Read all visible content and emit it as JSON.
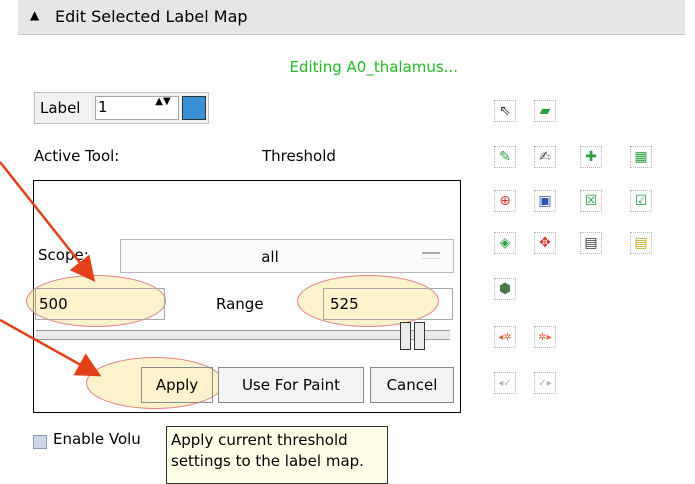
{
  "panel": {
    "title": "Edit Selected Label Map",
    "collapse_glyph": "▲",
    "status": "Editing A0_thalamus..."
  },
  "label": {
    "caption": "Label",
    "value": "1",
    "spin_glyph": "▲▼",
    "swatch_color": "#3b8fd6"
  },
  "active_tool": {
    "caption": "Active Tool:",
    "name": "Threshold"
  },
  "threshold": {
    "scope_label": "Scope:",
    "scope_value": "all",
    "min_value": "500",
    "range_label": "Range",
    "max_value": "525",
    "min": 500,
    "max": 525
  },
  "buttons": {
    "apply": "Apply",
    "use_for_paint": "Use For Paint",
    "cancel": "Cancel"
  },
  "footer": {
    "enable_label": "Enable Volu",
    "tooltip_line1": "Apply current threshold",
    "tooltip_line2": "settings to the label map."
  },
  "tools": [
    {
      "name": "pointer-tool-icon",
      "glyph": "⇖",
      "color": "#333333"
    },
    {
      "name": "eraser-tool-icon",
      "glyph": "▰",
      "color": "#2e9e44"
    },
    {
      "name": "paint-brush-tool-icon",
      "glyph": "✎",
      "color": "#2e9e44"
    },
    {
      "name": "draw-tool-icon",
      "glyph": "✍",
      "color": "#555555"
    },
    {
      "name": "level-tracing-tool-icon",
      "glyph": "✚",
      "color": "#2e9e44"
    },
    {
      "name": "grid-tool-icon",
      "glyph": "▦",
      "color": "#2e9e44"
    },
    {
      "name": "identify-islands-tool-icon",
      "glyph": "⊕",
      "color": "#d23b2b"
    },
    {
      "name": "change-label-tool-icon",
      "glyph": "▣",
      "color": "#3355aa"
    },
    {
      "name": "remove-islands-tool-icon",
      "glyph": "☒",
      "color": "#2e9e44"
    },
    {
      "name": "save-island-tool-icon",
      "glyph": "☑",
      "color": "#2e9e44"
    },
    {
      "name": "dilate-tool-icon",
      "glyph": "◈",
      "color": "#2e9e44"
    },
    {
      "name": "erode-tool-icon",
      "glyph": "✥",
      "color": "#d23b2b"
    },
    {
      "name": "morphology-tool-icon",
      "glyph": "▤",
      "color": "#333333"
    },
    {
      "name": "make-model-tool-icon",
      "glyph": "▤",
      "color": "#c9a218"
    },
    {
      "name": "wand-effect-tool-icon",
      "glyph": "⬢",
      "color": "#4a7a4a"
    },
    {
      "name": "undo-icon",
      "glyph": "◂✲",
      "color": "#e0603a"
    },
    {
      "name": "redo-icon",
      "glyph": "✲▸",
      "color": "#e0603a"
    },
    {
      "name": "check-left-icon",
      "glyph": "◂✓",
      "color": "#b0b0b0"
    },
    {
      "name": "check-right-icon",
      "glyph": "✓▸",
      "color": "#b0b0b0"
    }
  ],
  "colors": {
    "status_green": "#22bb22",
    "highlight_fill": "#fae8a0",
    "highlight_border": "#e67f7f",
    "arrow_red": "#e3401a"
  }
}
